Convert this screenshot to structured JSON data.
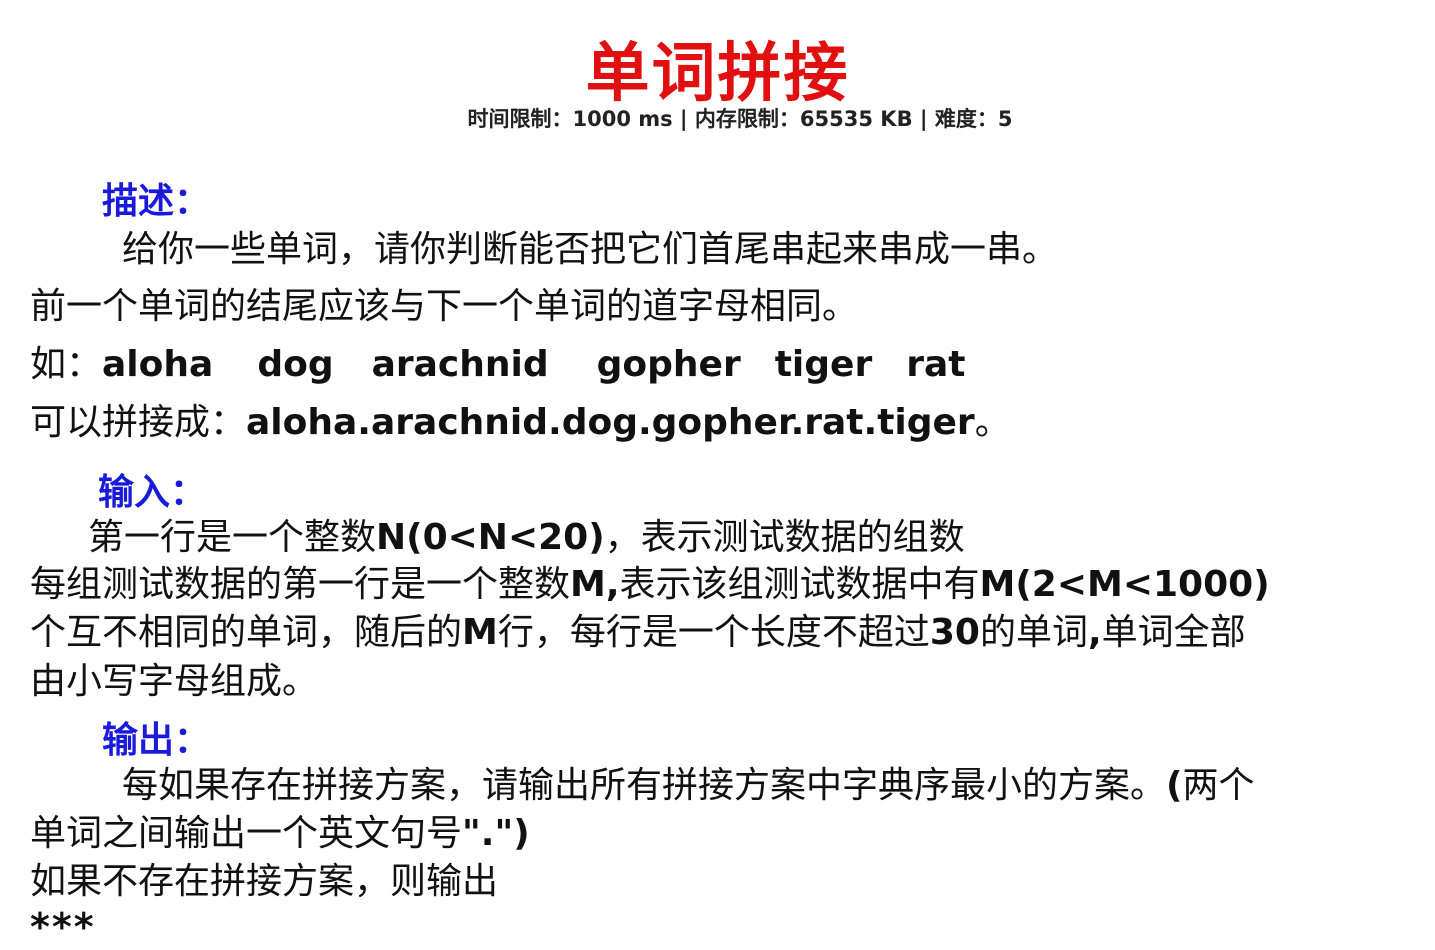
{
  "title": "单词拼接",
  "meta": {
    "time_label": "时间限制：",
    "time_value": "1000 ms",
    "sep1": " | ",
    "mem_label": "内存限制：",
    "mem_value": "65535 KB",
    "sep2": " | ",
    "diff_label": "难度：",
    "diff_value": "5"
  },
  "sections": {
    "description": "描述：",
    "input": "输入：",
    "output": "输出："
  },
  "description": {
    "line1": "给你一些单词，请你判断能否把它们首尾串起来串成一串。",
    "line2": "前一个单词的结尾应该与下一个单词的道字母相同。",
    "example_prefix": "如：",
    "example_words": [
      "aloha",
      "dog",
      "arachnid",
      "gopher",
      "tiger",
      "rat"
    ],
    "result_prefix": "可以拼接成：",
    "result_value": "aloha.arachnid.dog.gopher.rat.tiger",
    "result_suffix": "。"
  },
  "input": {
    "l1_a": "第一行是一个整数",
    "l1_b": "N(0<N<20)",
    "l1_c": "，表示测试数据的组数",
    "l2_a": "每组测试数据的第一行是一个整数",
    "l2_b": "M,",
    "l2_c": "表示该组测试数据中有",
    "l2_d": "M(2<M<1000)",
    "l3_a": "个互不相同的单词，随后的",
    "l3_b": "M",
    "l3_c": "行，每行是一个长度不超过",
    "l3_d": "30",
    "l3_e": "的单词",
    "l3_f": ",",
    "l3_g": "单词全部",
    "l4": "由小写字母组成。"
  },
  "output": {
    "l1_a": "每如果存在拼接方案，请输出所有拼接方案中字典序最小的方案。",
    "l1_b": "(",
    "l1_c": "两个",
    "l2_a": "单词之间输出一个英文句号",
    "l2_b": "\".\")",
    "l3": "如果不存在拼接方案，则输出",
    "l4": "***"
  },
  "colors": {
    "title": "#e01010",
    "section": "#1a1adb",
    "text": "#111111"
  }
}
